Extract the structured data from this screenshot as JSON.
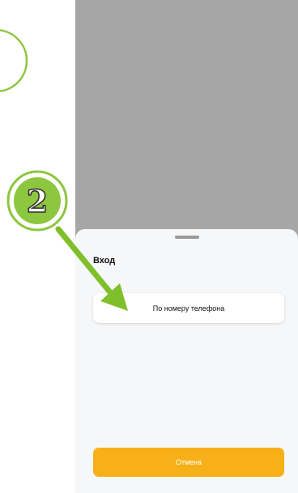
{
  "sheet": {
    "title": "Вход",
    "phone_login_label": "По номеру телефона",
    "cancel_label": "Отмена"
  },
  "annotation": {
    "step_number": "2"
  },
  "colors": {
    "accent_green": "#8dc63f",
    "cancel_orange": "#f7b01a",
    "dim_overlay": "#a6a6a6",
    "sheet_background": "#f6f7f9"
  },
  "icons": [
    "step-badge-icon",
    "arrow-icon",
    "grabber-icon"
  ]
}
